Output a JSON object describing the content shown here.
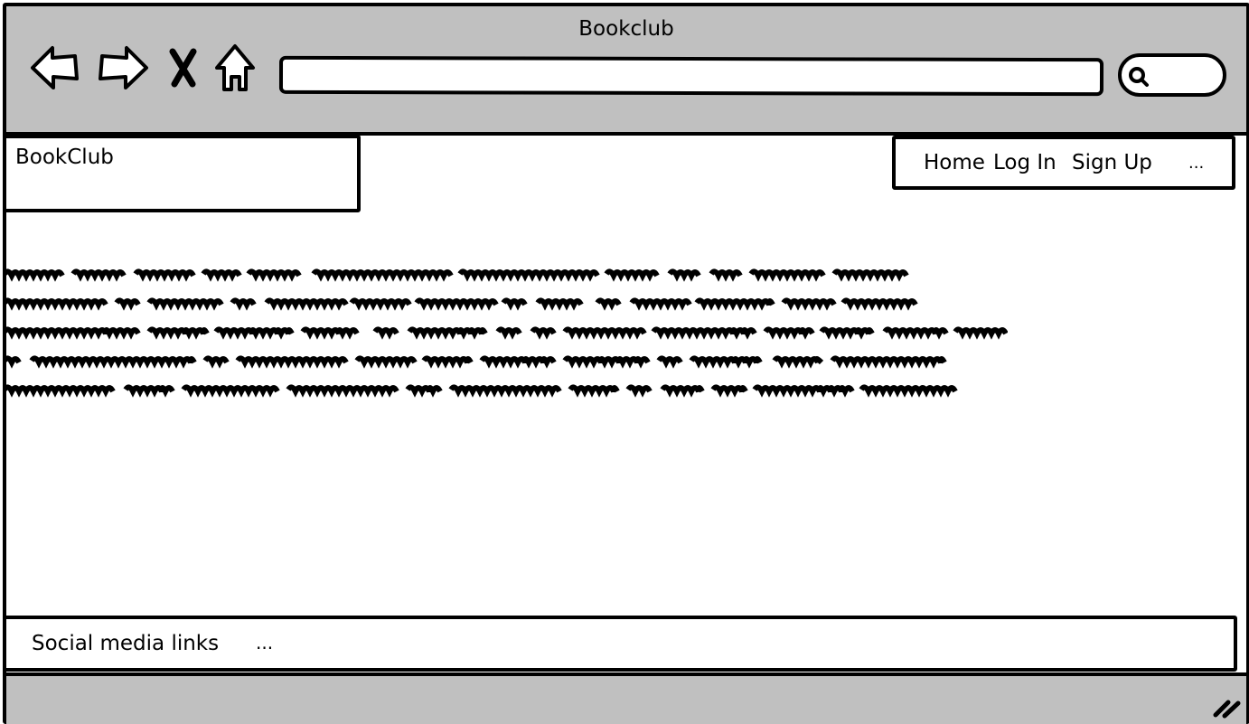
{
  "window": {
    "title": "Bookclub"
  },
  "browser": {
    "back_icon": "back-arrow-icon",
    "forward_icon": "forward-arrow-icon",
    "stop_icon": "close-x-icon",
    "home_icon": "home-icon",
    "url_value": "",
    "search_icon": "search-icon"
  },
  "site": {
    "brand": "BookClub",
    "nav": {
      "home": "Home",
      "login": "Log In",
      "signup": "Sign Up",
      "more": "..."
    }
  },
  "footer": {
    "label": "Social media links",
    "more": "..."
  },
  "colors": {
    "chrome_gray": "#c0c0c0",
    "ink": "#000000",
    "page": "#ffffff"
  }
}
